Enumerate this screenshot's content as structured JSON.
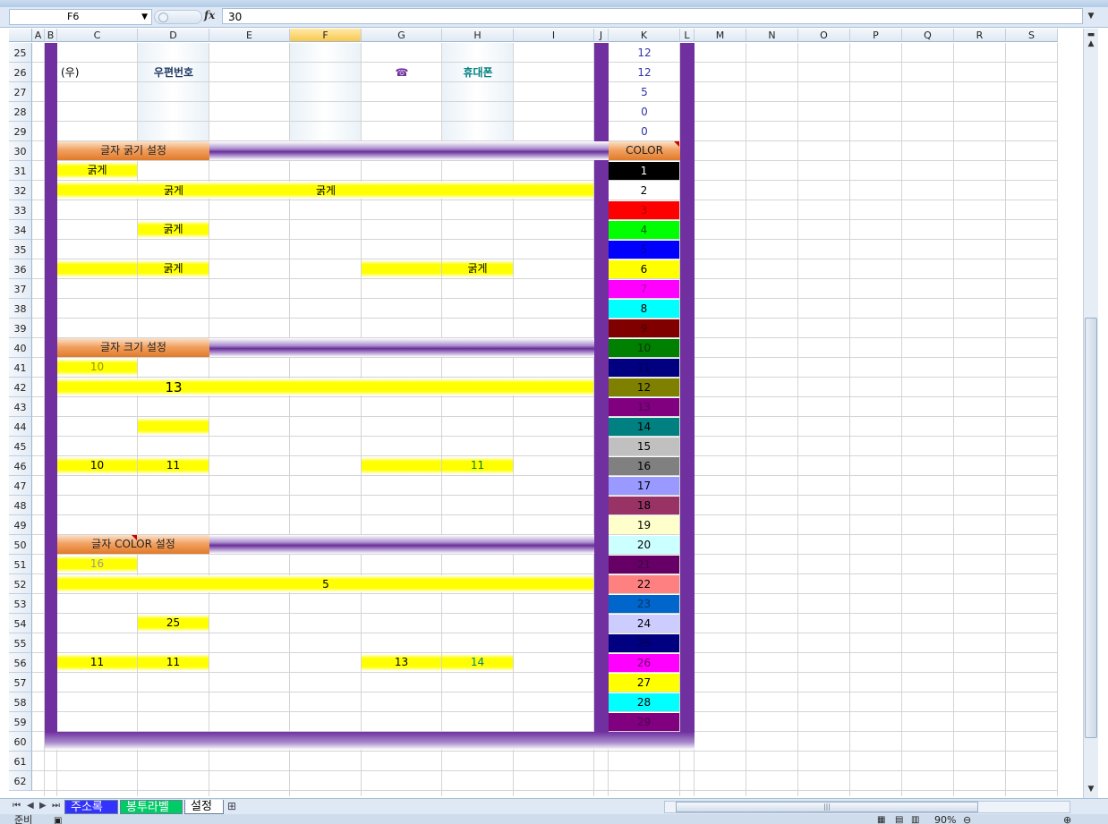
{
  "titlebar": {
    "text": ""
  },
  "formula_bar": {
    "cell_ref": "F6",
    "fx_label": "fx",
    "value": "30"
  },
  "columns": [
    "A",
    "B",
    "C",
    "D",
    "E",
    "F",
    "G",
    "H",
    "I",
    "J",
    "K",
    "L",
    "M",
    "N",
    "O",
    "P",
    "Q",
    "R",
    "S"
  ],
  "selected_column": "F",
  "rows": [
    "25",
    "26",
    "27",
    "28",
    "29",
    "30",
    "31",
    "32",
    "33",
    "34",
    "35",
    "36",
    "37",
    "38",
    "39",
    "40",
    "41",
    "42",
    "43",
    "44",
    "45",
    "46",
    "47",
    "48",
    "49",
    "50",
    "51",
    "52",
    "53",
    "54",
    "55",
    "56",
    "57",
    "58",
    "59",
    "60",
    "61",
    "62"
  ],
  "k_values_top": [
    "12",
    "12",
    "5",
    "0",
    "0"
  ],
  "row26": {
    "c": "(우)",
    "d": "우편번호",
    "g": "☎",
    "h": "휴대폰"
  },
  "sections": {
    "bold": {
      "title": "글자 굵기 설정",
      "bold_label": "굵게"
    },
    "size": {
      "title": "글자 크기 설정",
      "r41c": "10",
      "r42d": "13",
      "r46c": "10",
      "r46d": "11",
      "r46h": "11"
    },
    "color": {
      "title": "글자 COLOR 설정",
      "r51c": "16",
      "r52f": "5",
      "r54d": "25",
      "r56c": "11",
      "r56d": "11",
      "r56g": "13",
      "r56h": "14"
    }
  },
  "palette": {
    "title": "COLOR",
    "items": [
      {
        "n": "1",
        "bg": "#000000",
        "fg": "#ffffff"
      },
      {
        "n": "2",
        "bg": "#ffffff",
        "fg": "#000000"
      },
      {
        "n": "3",
        "bg": "#ff0000",
        "fg": "#aa0000"
      },
      {
        "n": "4",
        "bg": "#00ff00",
        "fg": "#006600"
      },
      {
        "n": "5",
        "bg": "#0000ff",
        "fg": "#000099"
      },
      {
        "n": "6",
        "bg": "#ffff00",
        "fg": "#000000"
      },
      {
        "n": "7",
        "bg": "#ff00ff",
        "fg": "#aa00aa"
      },
      {
        "n": "8",
        "bg": "#00ffff",
        "fg": "#000000"
      },
      {
        "n": "9",
        "bg": "#800000",
        "fg": "#500000"
      },
      {
        "n": "10",
        "bg": "#008000",
        "fg": "#003300"
      },
      {
        "n": "11",
        "bg": "#000080",
        "fg": "#000050"
      },
      {
        "n": "12",
        "bg": "#808000",
        "fg": "#000000"
      },
      {
        "n": "13",
        "bg": "#800080",
        "fg": "#500050"
      },
      {
        "n": "14",
        "bg": "#008080",
        "fg": "#000000"
      },
      {
        "n": "15",
        "bg": "#c0c0c0",
        "fg": "#000000"
      },
      {
        "n": "16",
        "bg": "#808080",
        "fg": "#000000"
      },
      {
        "n": "17",
        "bg": "#9999ff",
        "fg": "#000000"
      },
      {
        "n": "18",
        "bg": "#993366",
        "fg": "#000000"
      },
      {
        "n": "19",
        "bg": "#ffffcc",
        "fg": "#000000"
      },
      {
        "n": "20",
        "bg": "#ccffff",
        "fg": "#000000"
      },
      {
        "n": "21",
        "bg": "#660066",
        "fg": "#440044"
      },
      {
        "n": "22",
        "bg": "#ff8080",
        "fg": "#000000"
      },
      {
        "n": "23",
        "bg": "#0066cc",
        "fg": "#003366"
      },
      {
        "n": "24",
        "bg": "#ccccff",
        "fg": "#000000"
      },
      {
        "n": "25",
        "bg": "#000080",
        "fg": "#000050"
      },
      {
        "n": "26",
        "bg": "#ff00ff",
        "fg": "#660066"
      },
      {
        "n": "27",
        "bg": "#ffff00",
        "fg": "#000000"
      },
      {
        "n": "28",
        "bg": "#00ffff",
        "fg": "#000000"
      },
      {
        "n": "29",
        "bg": "#800080",
        "fg": "#500050"
      }
    ]
  },
  "sheet_tabs": [
    {
      "label": "주소록",
      "active": false,
      "bg": "#3333ff",
      "fg": "#ffffff"
    },
    {
      "label": "봉투라벨",
      "active": false,
      "bg": "#00cc66",
      "fg": "#ffffff"
    },
    {
      "label": "설정",
      "active": true,
      "bg": "#ffffff",
      "fg": "#000000"
    }
  ],
  "status": {
    "left": "준비",
    "zoom": "90%"
  },
  "colors": {
    "purple": "#7030a0",
    "yellow": "#ffff00",
    "orange": "#e07a2a"
  }
}
